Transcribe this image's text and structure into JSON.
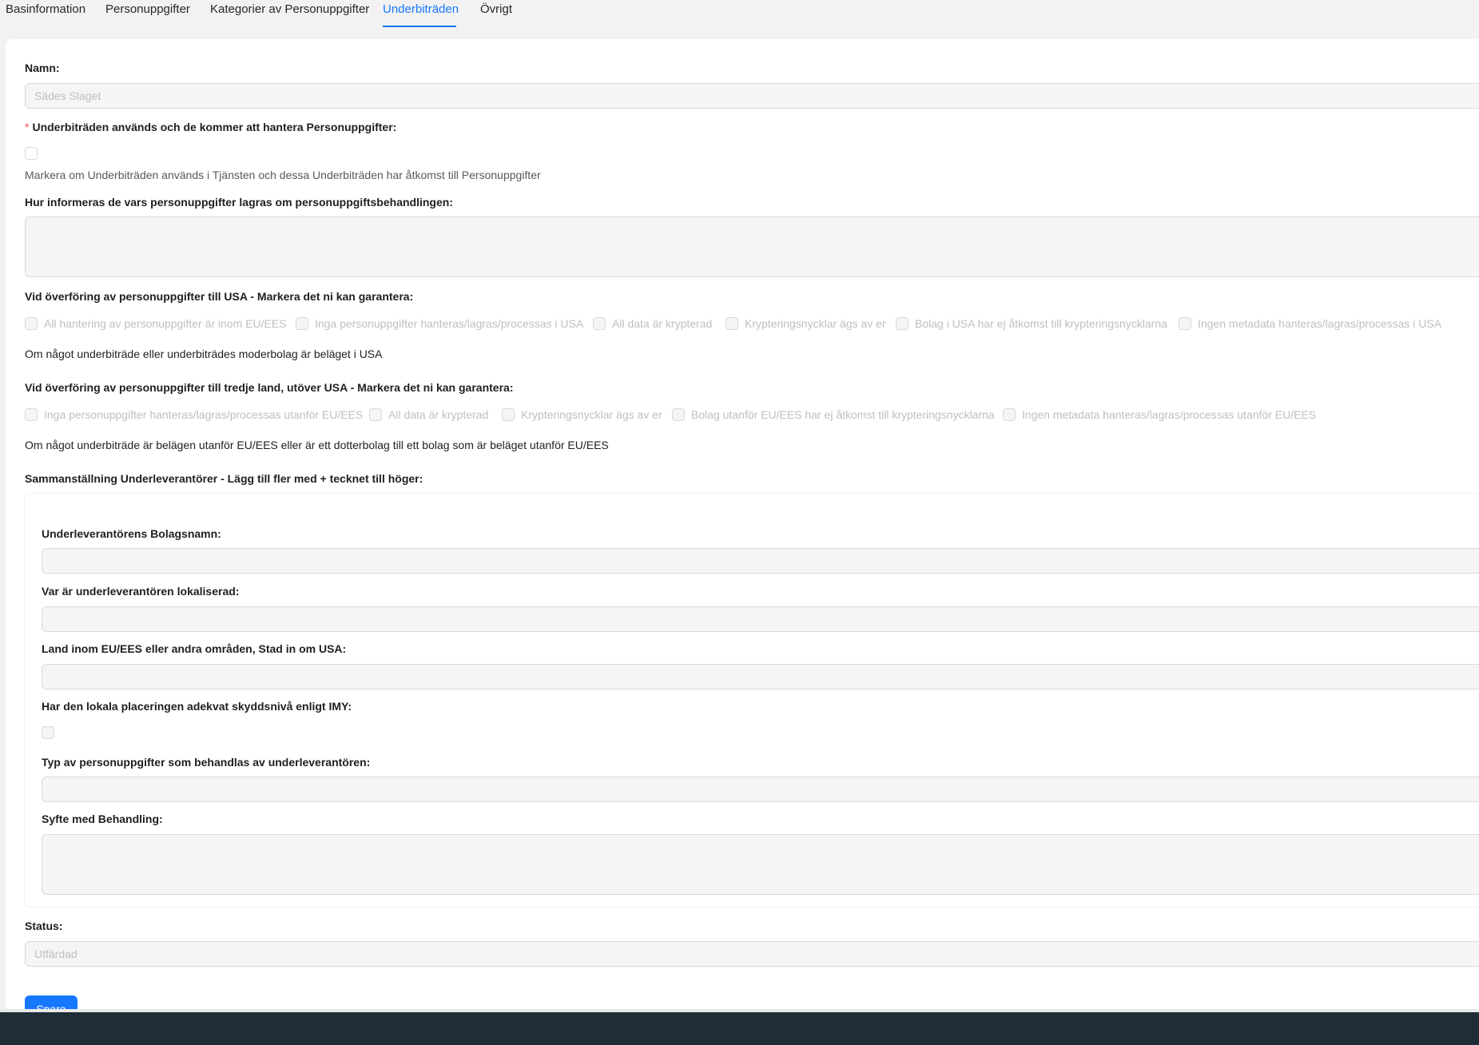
{
  "tabs": [
    {
      "label": "Basinformation",
      "active": false
    },
    {
      "label": "Personuppgifter",
      "active": false
    },
    {
      "label": "Kategorier av Personuppgifter",
      "active": false
    },
    {
      "label": "Underbiträden",
      "active": true
    },
    {
      "label": "Övrigt",
      "active": false
    }
  ],
  "form": {
    "name_label": "Namn",
    "name_value": "Sädes Slaget",
    "subprocessors_used": {
      "required_mark": "*",
      "label": "Underbiträden används och de kommer att hantera Personuppgifter",
      "checked": false,
      "help": "Markera om Underbiträden används i Tjänsten och dessa Underbiträden har åtkomst till Personuppgifter"
    },
    "inform_label": "Hur informeras de vars personuppgifter lagras om personuppgiftsbehandlingen",
    "inform_value": "",
    "usa": {
      "label": "Vid överföring av personuppgifter till USA - Markera det ni kan garantera",
      "options": [
        "All hantering av personuppgifter är inom EU/EES",
        "Inga personuppgifter hanteras/lagras/processas i USA",
        "All data är krypterad",
        "Krypteringsnycklar ägs av er",
        "Bolag i USA har ej åtkomst till krypteringsnycklarna",
        "Ingen metadata hanteras/lagras/processas i USA"
      ],
      "note": "Om något underbiträde eller underbiträdes moderbolag är beläget i USA"
    },
    "third": {
      "label": "Vid överföring av personuppgifter till tredje land, utöver USA - Markera det ni kan garantera",
      "options": [
        "Inga personuppgifter hanteras/lagras/processas utanför EU/EES",
        "All data är krypterad",
        "Krypteringsnycklar ägs av er",
        "Bolag utanför EU/EES har ej åtkomst till krypteringsnycklarna",
        "Ingen metadata hanteras/lagras/processas utanför EU/EES"
      ],
      "note": "Om något underbiträde är belägen utanför EU/EES eller är ett dotterbolag till ett bolag som är beläget utanför EU/EES"
    },
    "summary_label": "Sammanställning Underleverantörer - Lägg till fler med + tecknet till höger",
    "sub": {
      "company_label": "Underleverantörens Bolagsnamn",
      "company_value": "",
      "location_label": "Var är underleverantören lokaliserad",
      "location_value": "",
      "country_label": "Land inom EU/EES eller andra områden, Stad in om USA",
      "country_value": "",
      "imy_label": "Har den lokala placeringen adekvat skyddsnivå enligt IMY",
      "imy_checked": false,
      "type_label": "Typ av personuppgifter som behandlas av underleverantören",
      "type_value": "",
      "purpose_label": "Syfte med Behandling",
      "purpose_value": ""
    },
    "status_label": "Status",
    "status_value": "Utfärdad",
    "save_label": "Spara"
  },
  "colors": {
    "accent": "#1677ff",
    "required": "#ff4d4f",
    "taskbar": "#1f2e36"
  }
}
